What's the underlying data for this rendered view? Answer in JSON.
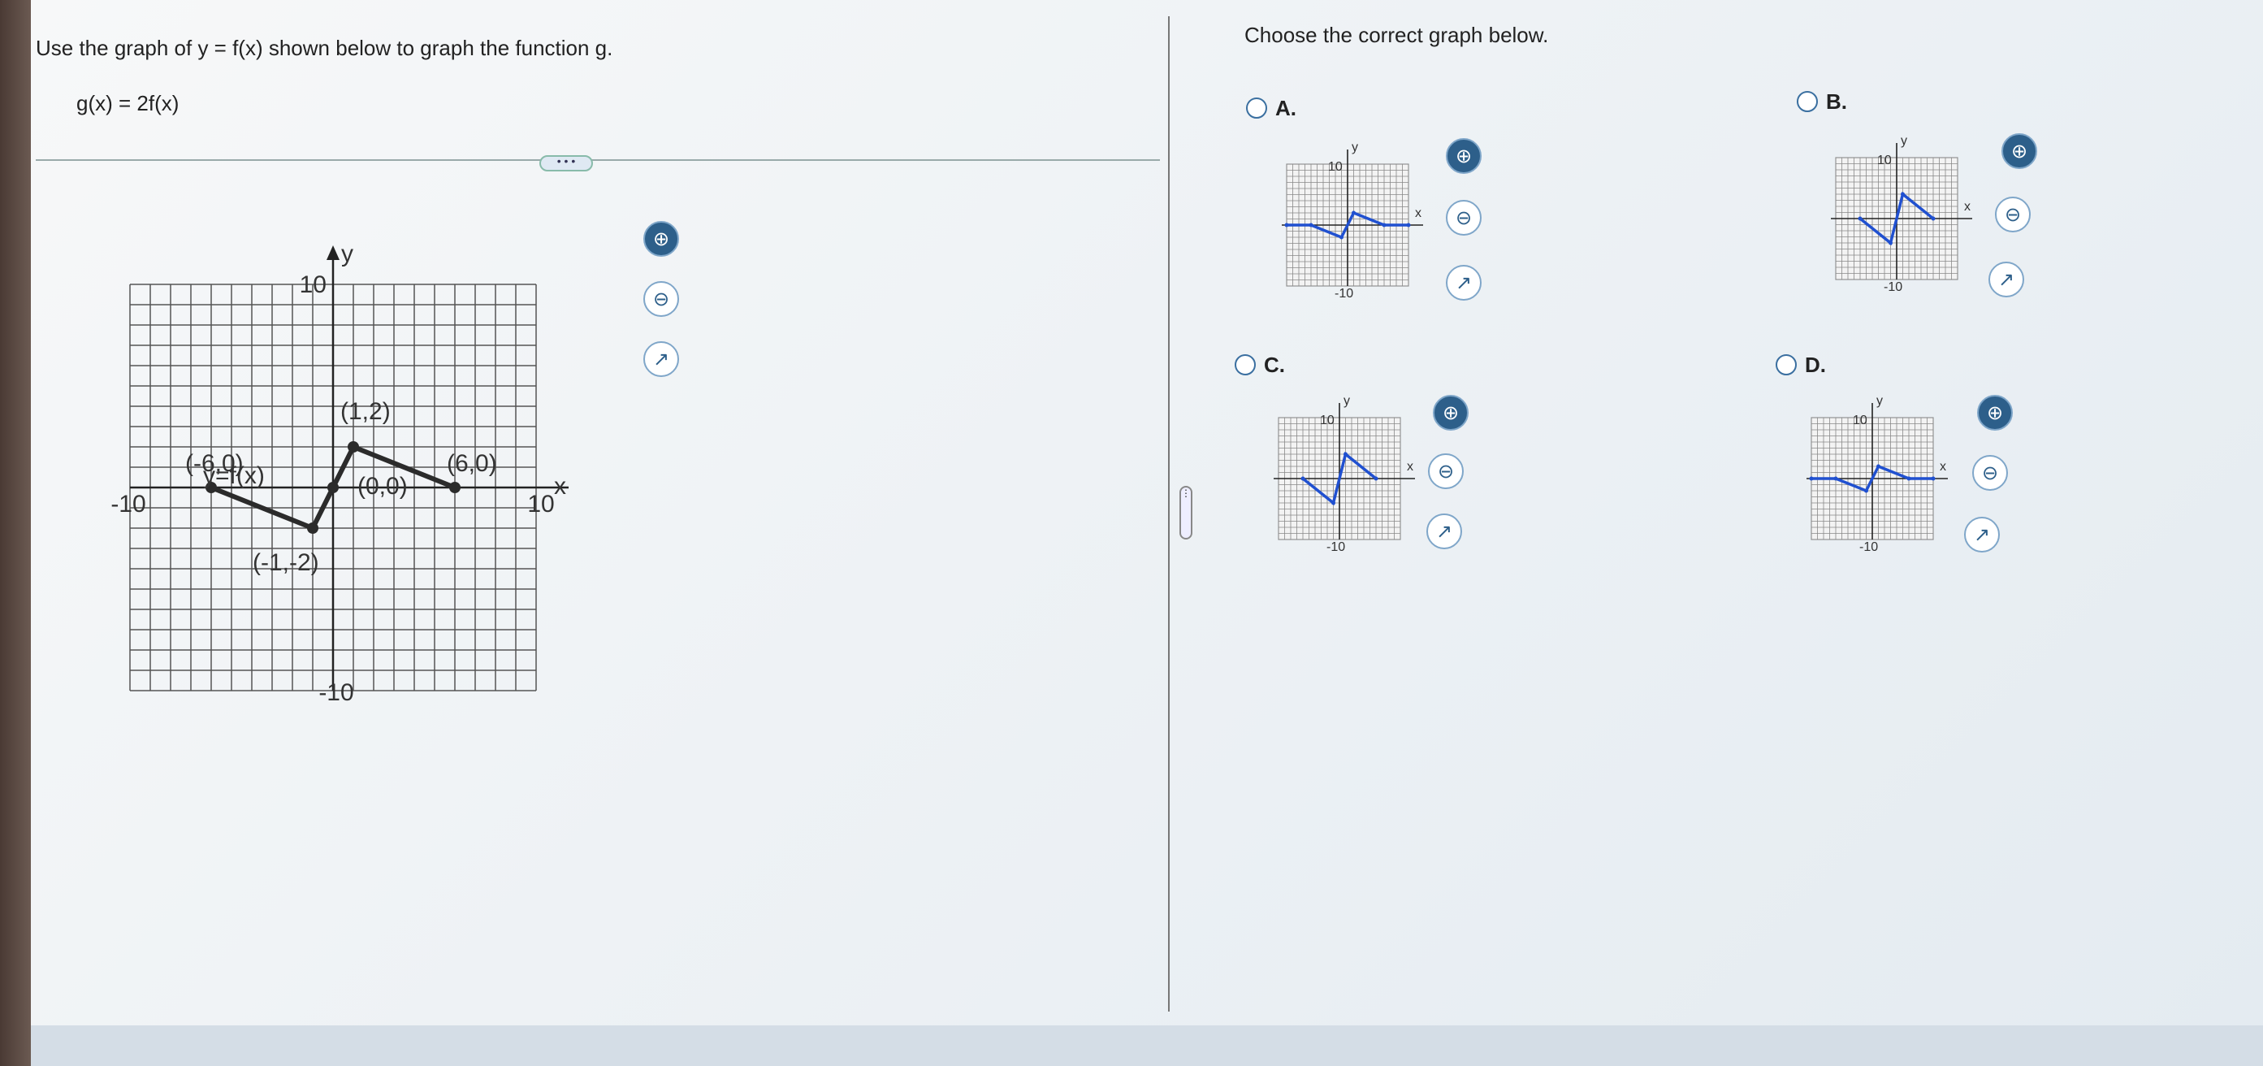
{
  "question": {
    "instruction": "Use the graph of y = f(x) shown below to graph the function g.",
    "equation": "g(x) = 2f(x)",
    "more_label": "• • •"
  },
  "main_graph": {
    "y_label": "y",
    "x_label": "x",
    "y_max_label": "10",
    "y_min_label": "-10",
    "x_min_label": "-10",
    "x_max_label": "10",
    "func_label": "y=f(x)",
    "points": [
      {
        "x": -6,
        "y": 0,
        "label": "(-6,0)"
      },
      {
        "x": -1,
        "y": -2,
        "label": "(-1,-2)"
      },
      {
        "x": 0,
        "y": 0,
        "label": "(0,0)"
      },
      {
        "x": 1,
        "y": 2,
        "label": "(1,2)"
      },
      {
        "x": 6,
        "y": 0,
        "label": "(6,0)"
      }
    ]
  },
  "answer_panel": {
    "prompt": "Choose the correct graph below.",
    "choices": [
      {
        "letter": "A.",
        "points": [
          [
            -10,
            0
          ],
          [
            -6,
            0
          ],
          [
            -1,
            -2
          ],
          [
            1,
            2
          ],
          [
            6,
            0
          ],
          [
            10,
            0
          ]
        ]
      },
      {
        "letter": "B.",
        "points": [
          [
            -6,
            0
          ],
          [
            -1,
            -4
          ],
          [
            1,
            4
          ],
          [
            6,
            0
          ]
        ]
      },
      {
        "letter": "C.",
        "points": [
          [
            -6,
            0
          ],
          [
            -1,
            -4
          ],
          [
            1,
            4
          ],
          [
            6,
            0
          ]
        ]
      },
      {
        "letter": "D.",
        "points": [
          [
            -10,
            0
          ],
          [
            -6,
            0
          ],
          [
            -1,
            -2
          ],
          [
            1,
            2
          ],
          [
            6,
            0
          ],
          [
            10,
            0
          ]
        ]
      }
    ],
    "mini_y_label": "y",
    "mini_x_label": "x",
    "mini_10": "10",
    "mini_neg10": "-10",
    "series_color": "#2050d0"
  },
  "icons": {
    "zoom_in": "⊕",
    "zoom_out": "⊖",
    "popout": "↗"
  }
}
